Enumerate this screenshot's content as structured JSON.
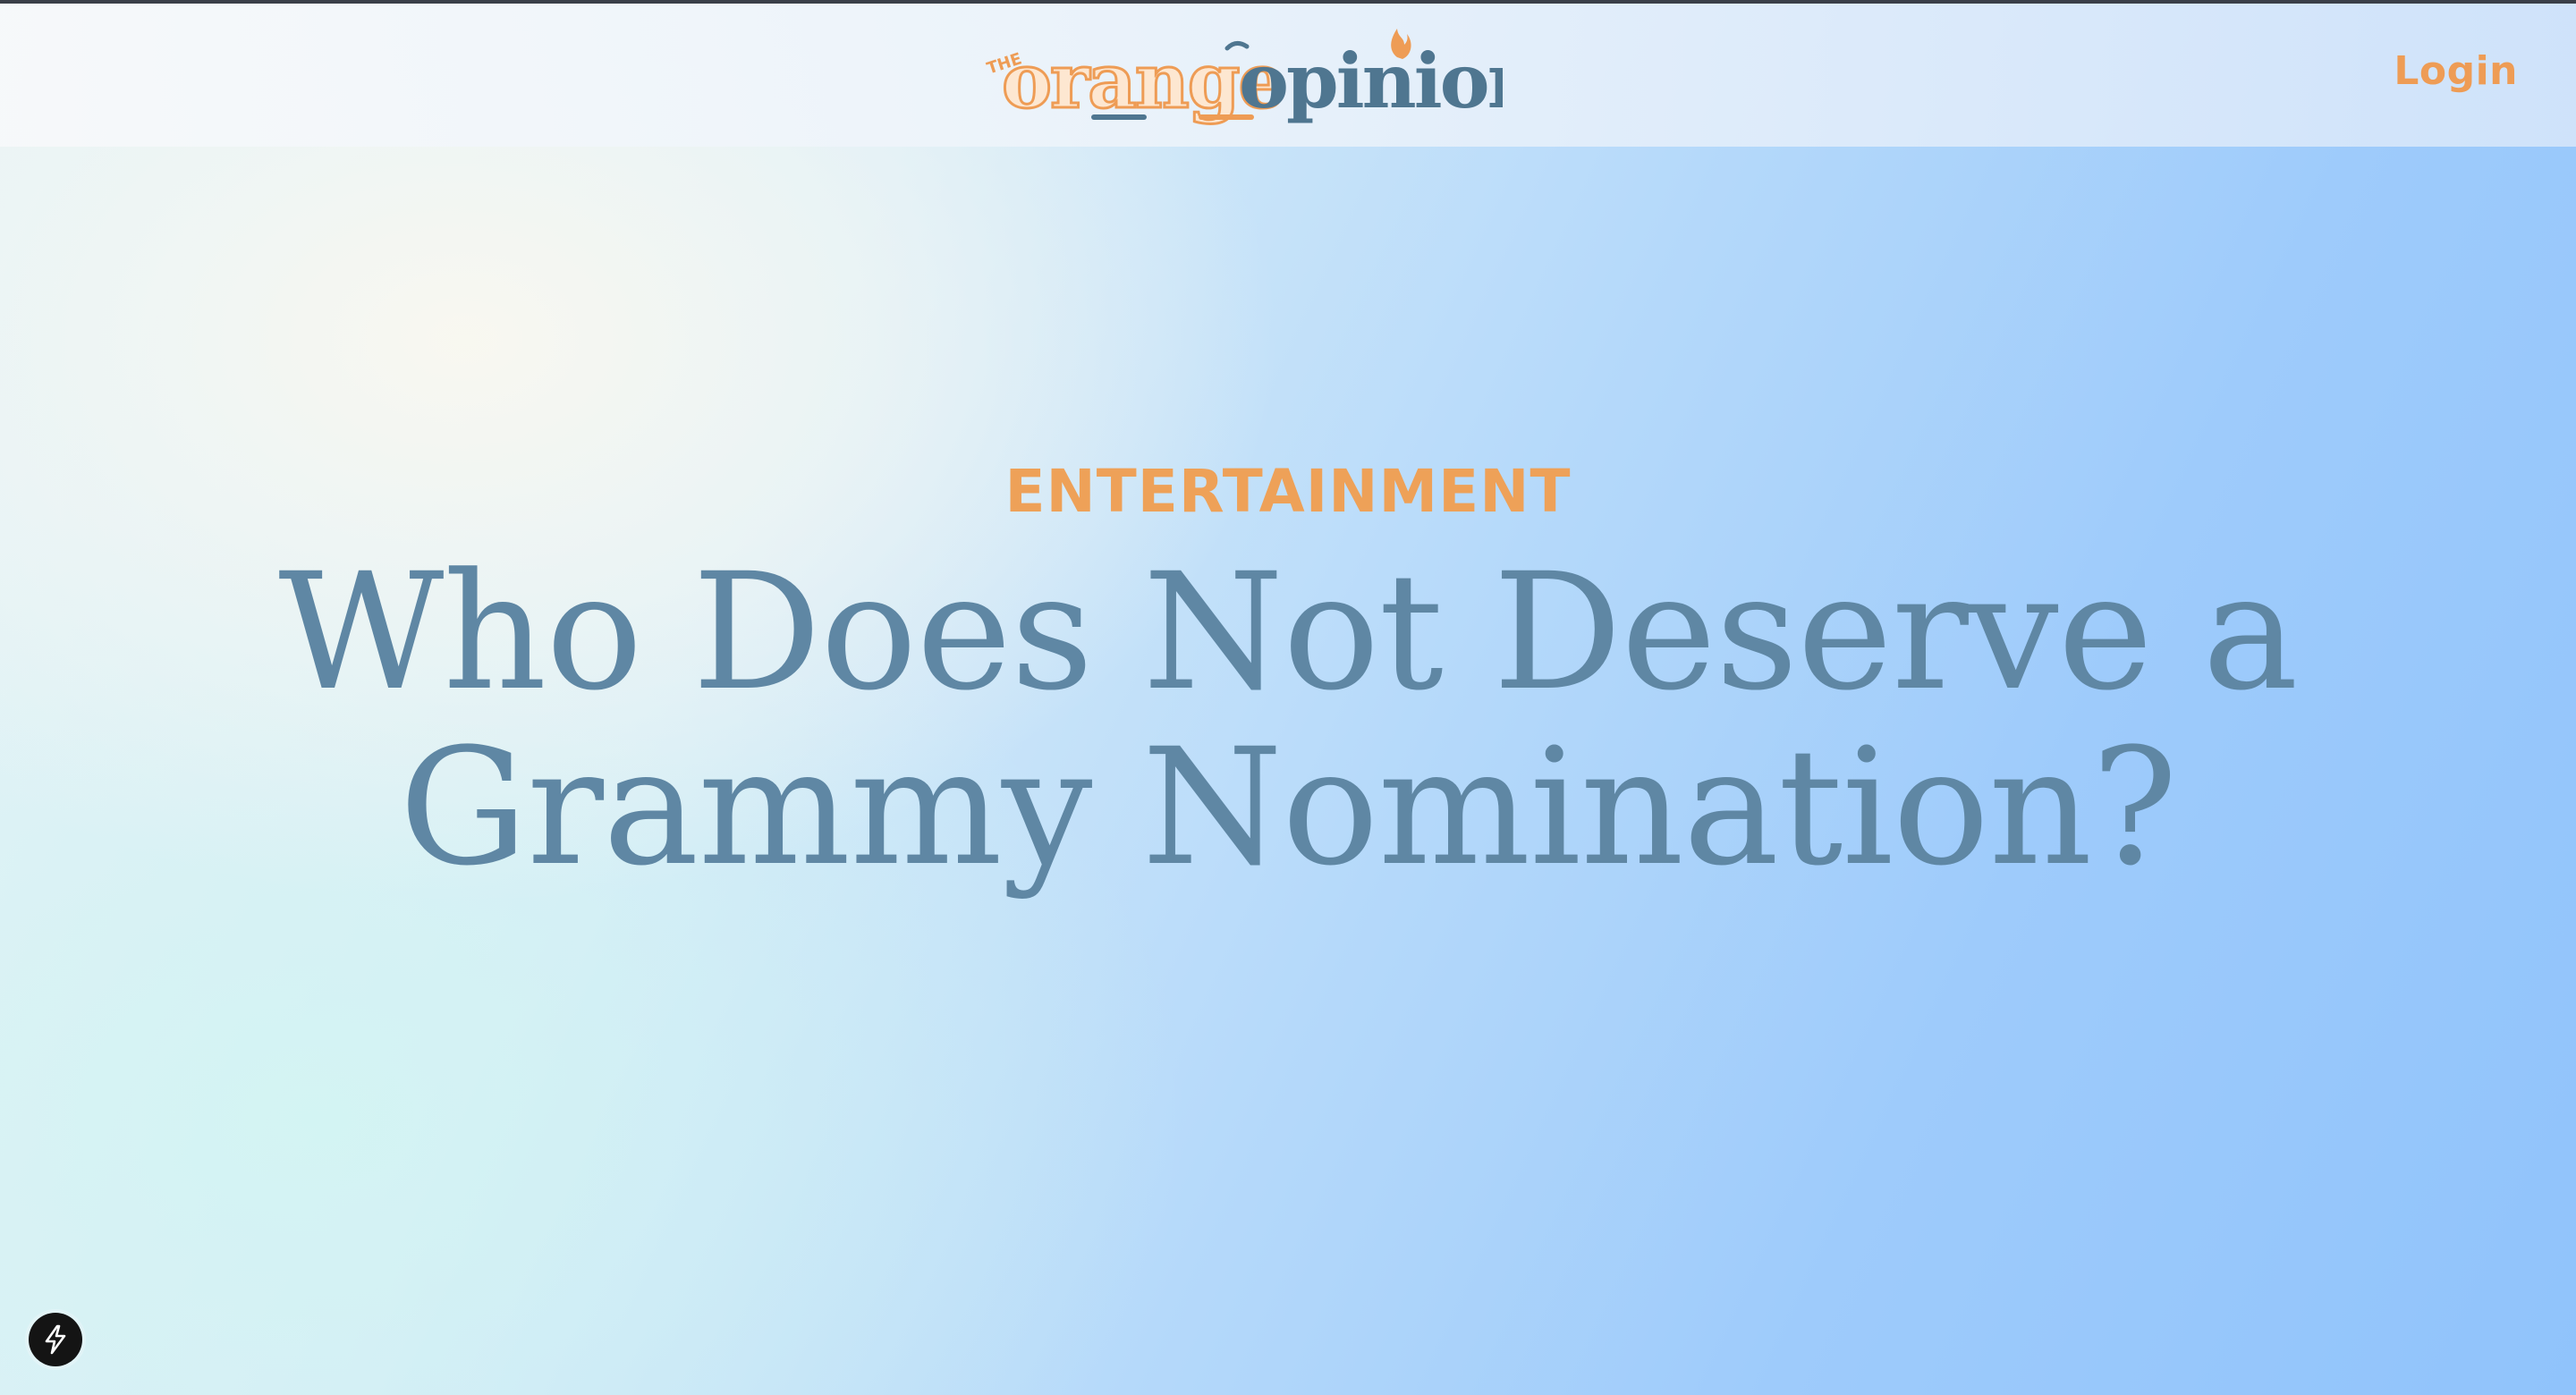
{
  "header": {
    "logo": {
      "prefix": "THE",
      "word1": "orange",
      "word2": "opinion"
    },
    "login_label": "Login"
  },
  "hero": {
    "category": "ENTERTAINMENT",
    "title": "Who Does Not Deserve a Grammy Nomination?"
  },
  "colors": {
    "accent_orange": "#ee9c55",
    "headline_blue": "#5f87a4",
    "logo_slate": "#4f7690"
  },
  "icons": {
    "nav_badge": "lightning-bolt-icon",
    "logo_flame": "flame-icon"
  }
}
